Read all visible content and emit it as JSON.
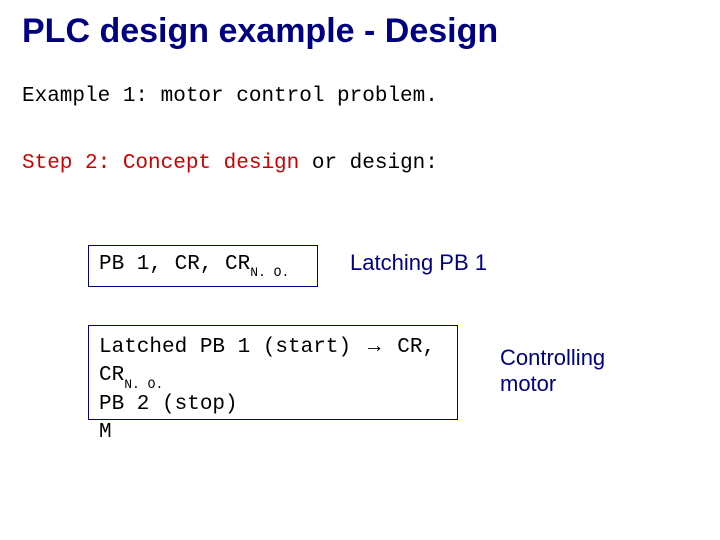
{
  "title": "PLC design example - Design",
  "example_line": "Example 1: motor control problem.",
  "step_line": {
    "red": "Step 2: Concept design",
    "black": " or design:"
  },
  "box1": {
    "prefix": "PB 1, CR, CR",
    "subscript": "N. O."
  },
  "box2": {
    "line1_prefix": "Latched PB 1 (start) ",
    "line1_arrow": "→",
    "line1_mid": " CR, CR",
    "line1_subscript": "N. O.",
    "line2": "PB 2 (stop)",
    "line3": "M"
  },
  "label1": "Latching PB 1",
  "label2_line1": "Controlling",
  "label2_line2": "motor"
}
